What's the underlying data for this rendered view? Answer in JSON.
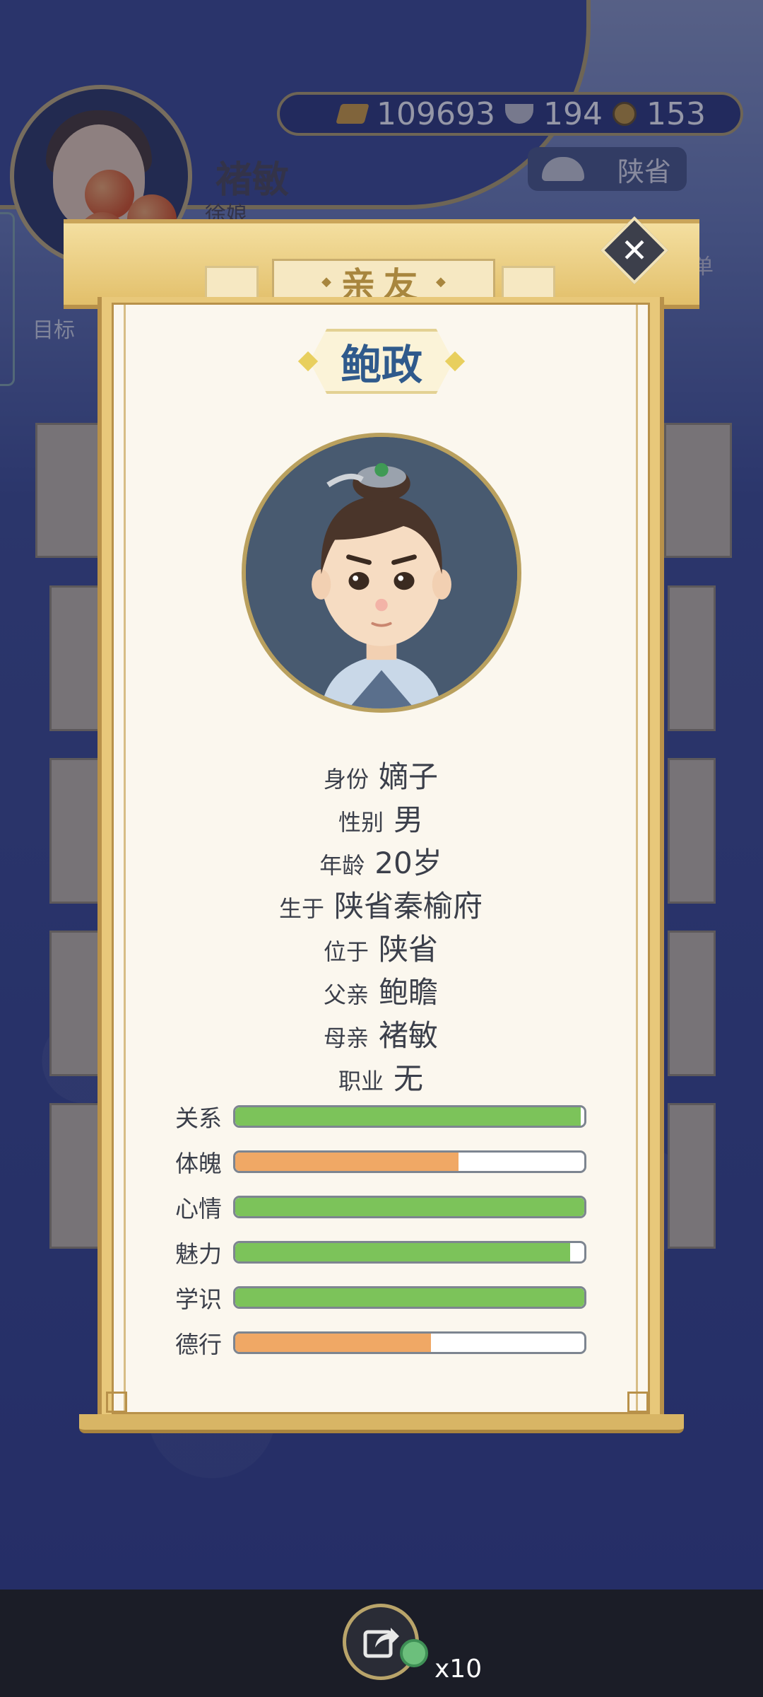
{
  "header": {
    "player_name": "褚敏",
    "player_subtitle": "徐娘",
    "gold": "109693",
    "silver": "194",
    "coins": "153",
    "location": "陕省",
    "menu_label": "菜单",
    "goal_label": "目标"
  },
  "dialog": {
    "title": "亲友",
    "close_label": "✕",
    "name": "鲍政",
    "info": [
      {
        "key": "身份",
        "value": "嫡子"
      },
      {
        "key": "性别",
        "value": "男"
      },
      {
        "key": "年龄",
        "value": "20岁"
      },
      {
        "key": "生于",
        "value": "陕省秦榆府"
      },
      {
        "key": "位于",
        "value": "陕省"
      },
      {
        "key": "父亲",
        "value": "鲍瞻"
      },
      {
        "key": "母亲",
        "value": "褚敏"
      },
      {
        "key": "职业",
        "value": "无"
      }
    ],
    "stats": [
      {
        "label": "关系",
        "fraction": 0.99,
        "color": "#7cc35a"
      },
      {
        "label": "体魄",
        "fraction": 0.64,
        "color": "#f0a865"
      },
      {
        "label": "心情",
        "fraction": 1.0,
        "color": "#7cc35a"
      },
      {
        "label": "魅力",
        "fraction": 0.96,
        "color": "#7cc35a"
      },
      {
        "label": "学识",
        "fraction": 1.0,
        "color": "#7cc35a"
      },
      {
        "label": "德行",
        "fraction": 0.56,
        "color": "#f0a865"
      }
    ]
  },
  "footer": {
    "item_count": "x10"
  }
}
